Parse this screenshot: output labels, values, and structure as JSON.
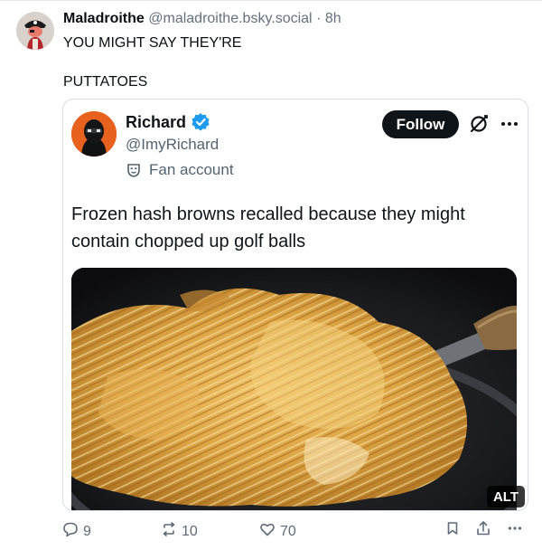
{
  "post": {
    "author_name": "Maladroithe",
    "author_handle": "@maladroithe.bsky.social",
    "separator": "·",
    "time": "8h",
    "text_lines": [
      "YOU MIGHT SAY THEY'RE",
      "PUTTATOES"
    ]
  },
  "embed": {
    "name": "Richard",
    "handle": "@ImyRichard",
    "tag": "Fan account",
    "follow_label": "Follow",
    "text_lines": [
      "Frozen hash browns recalled because they might",
      "contain chopped up golf balls"
    ],
    "alt_label": "ALT"
  },
  "actions": {
    "replies": "9",
    "reposts": "10",
    "likes": "70"
  },
  "colors": {
    "verified": "#1d9bf0",
    "avatar_orange": "#e8611f",
    "follow_bg": "#0f1419",
    "muted_text": "#66717d"
  },
  "icons": [
    "reply-icon",
    "repost-icon",
    "like-icon",
    "bookmark-icon",
    "share-icon",
    "more-icon",
    "verified-icon",
    "mask-icon",
    "grok-icon"
  ]
}
